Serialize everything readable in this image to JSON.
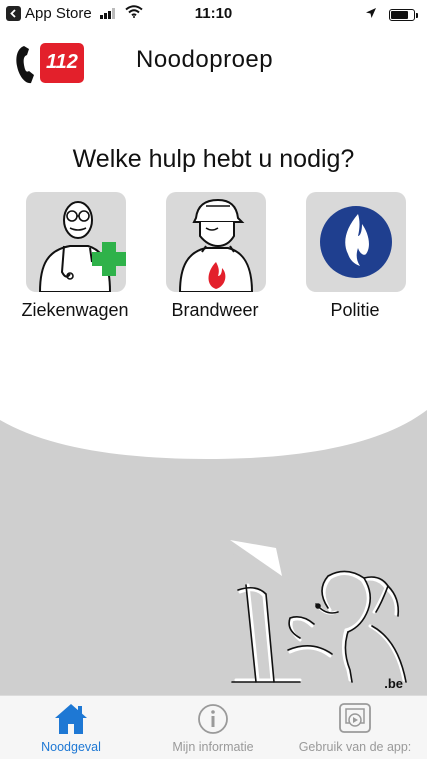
{
  "status_bar": {
    "back_app": "App Store",
    "time": "11:10"
  },
  "header": {
    "logo_text": "112",
    "title": "Noodoproep"
  },
  "question": "Welke hulp hebt u nodig?",
  "services": [
    {
      "label": "Ziekenwagen",
      "icon": "paramedic-icon"
    },
    {
      "label": "Brandweer",
      "icon": "firefighter-icon"
    },
    {
      "label": "Politie",
      "icon": "police-flame-icon"
    }
  ],
  "footer_brand": ".be",
  "tabs": [
    {
      "label": "Noodgeval",
      "icon": "home-icon",
      "active": true
    },
    {
      "label": "Mijn informatie",
      "icon": "info-icon",
      "active": false
    },
    {
      "label": "Gebruik van de app:",
      "icon": "video-icon",
      "active": false
    }
  ],
  "colors": {
    "brand_red": "#e3202b",
    "active_blue": "#1e78d4",
    "inactive_gray": "#9a9a9a",
    "tile_gray": "#d9d9d9",
    "speech_gray": "#cfcfcf",
    "police_blue": "#1f3f8f",
    "cross_green": "#2fb24a"
  }
}
